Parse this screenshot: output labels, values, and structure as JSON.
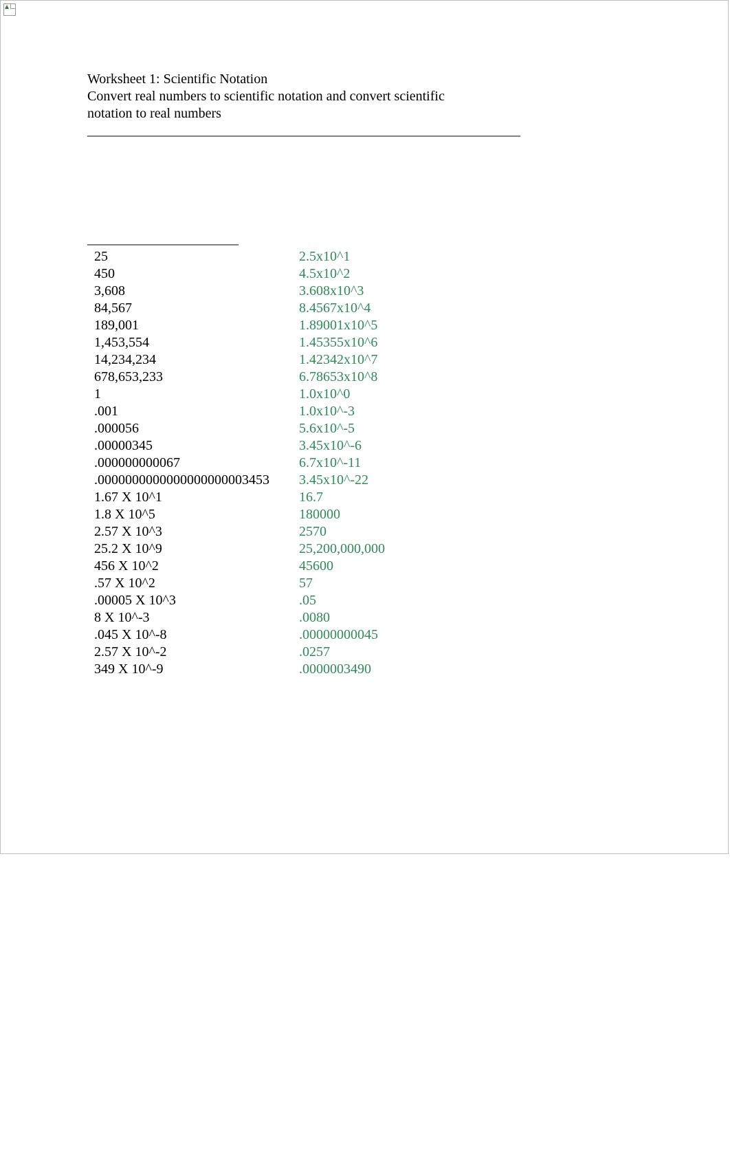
{
  "title": "Worksheet 1: Scientific Notation",
  "subtitle": "Convert real numbers to scientific notation and convert scientific notation to real numbers",
  "hr1": "_______________________________________________________________",
  "hr2": "______________________",
  "rows": [
    {
      "left": "25",
      "right": "2.5x10^1"
    },
    {
      "left": "450",
      "right": "4.5x10^2"
    },
    {
      "left": "3,608",
      "right": "3.608x10^3"
    },
    {
      "left": "84,567",
      "right": "8.4567x10^4"
    },
    {
      "left": "189,001",
      "right": "1.89001x10^5"
    },
    {
      "left": "1,453,554",
      "right": "1.45355x10^6"
    },
    {
      "left": "14,234,234",
      "right": "1.42342x10^7"
    },
    {
      "left": "678,653,233",
      "right": "6.78653x10^8"
    },
    {
      "left": "1",
      "right": "1.0x10^0"
    },
    {
      "left": ".001",
      "right": "1.0x10^-3"
    },
    {
      "left": ".000056",
      "right": "5.6x10^-5"
    },
    {
      "left": ".00000345",
      "right": "3.45x10^-6"
    },
    {
      "left": ".000000000067",
      "right": "6.7x10^-11"
    },
    {
      "left": ".0000000000000000000003453",
      "right": "3.45x10^-22"
    },
    {
      "left": "1.67 X 10^1",
      "right": "16.7"
    },
    {
      "left": "1.8 X 10^5",
      "right": "180000"
    },
    {
      "left": "2.57 X 10^3",
      "right": "2570"
    },
    {
      "left": "25.2 X 10^9",
      "right": "25,200,000,000"
    },
    {
      "left": "456 X 10^2",
      "right": "45600"
    },
    {
      "left": ".57 X 10^2",
      "right": "57"
    },
    {
      "left": ".00005 X 10^3",
      "right": ".05"
    },
    {
      "left": "8 X 10^-3",
      "right": ".0080"
    },
    {
      "left": ".045 X 10^-8",
      "right": ".00000000045"
    },
    {
      "left": "2.57 X 10^-2",
      "right": ".0257"
    },
    {
      "left": "349 X 10^-9",
      "right": ".0000003490"
    }
  ]
}
